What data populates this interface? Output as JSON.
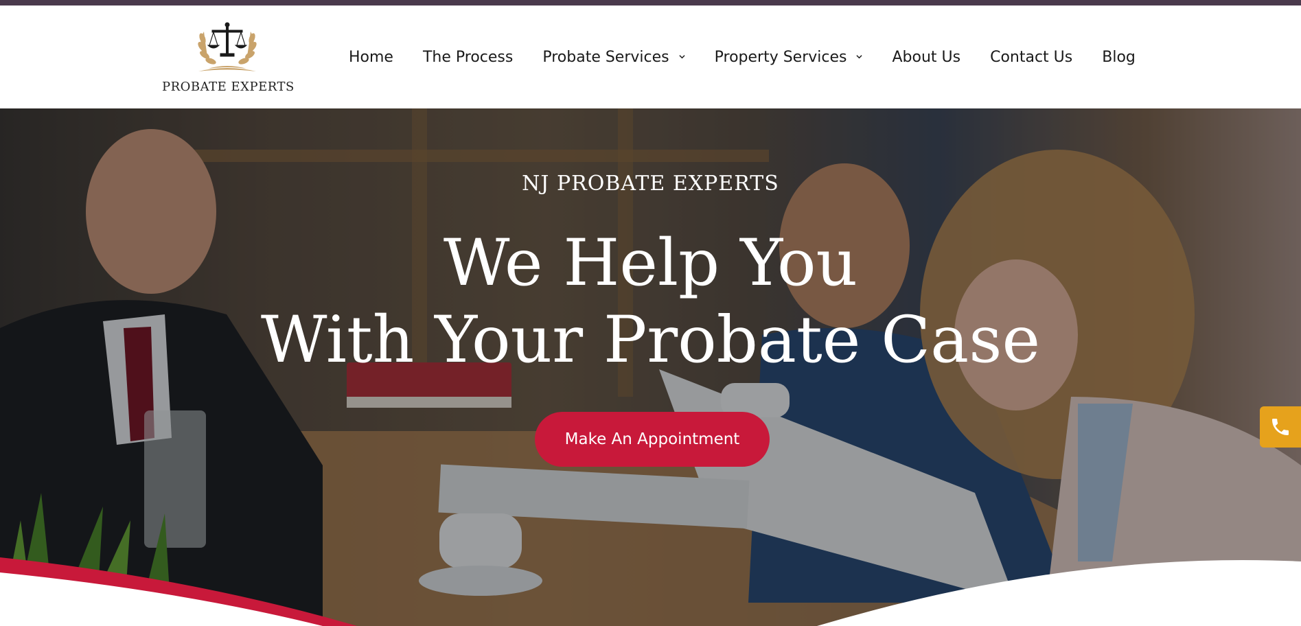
{
  "brand": {
    "logo_text": "PROBATE EXPERTS",
    "gold": "#c9a36b",
    "dark": "#1a1a1a"
  },
  "nav": {
    "items": [
      {
        "label": "Home",
        "has_dropdown": false
      },
      {
        "label": "The Process",
        "has_dropdown": false
      },
      {
        "label": "Probate Services",
        "has_dropdown": true
      },
      {
        "label": "Property Services",
        "has_dropdown": true
      },
      {
        "label": "About Us",
        "has_dropdown": false
      },
      {
        "label": "Contact Us",
        "has_dropdown": false
      },
      {
        "label": "Blog",
        "has_dropdown": false
      }
    ]
  },
  "hero": {
    "subtitle": "NJ PROBATE EXPERTS",
    "title_line1": "We Help You",
    "title_line2": "With Your Probate Case",
    "cta_label": "Make An Appointment"
  },
  "icons": {
    "logo": "scales-of-justice-laurel-icon",
    "dropdown": "chevron-down-icon",
    "phone": "phone-icon"
  },
  "colors": {
    "top_strip": "#4a3a4c",
    "cta": "#c8193a",
    "phone_tab": "#e6a21c",
    "wave_red": "#c8193a"
  }
}
